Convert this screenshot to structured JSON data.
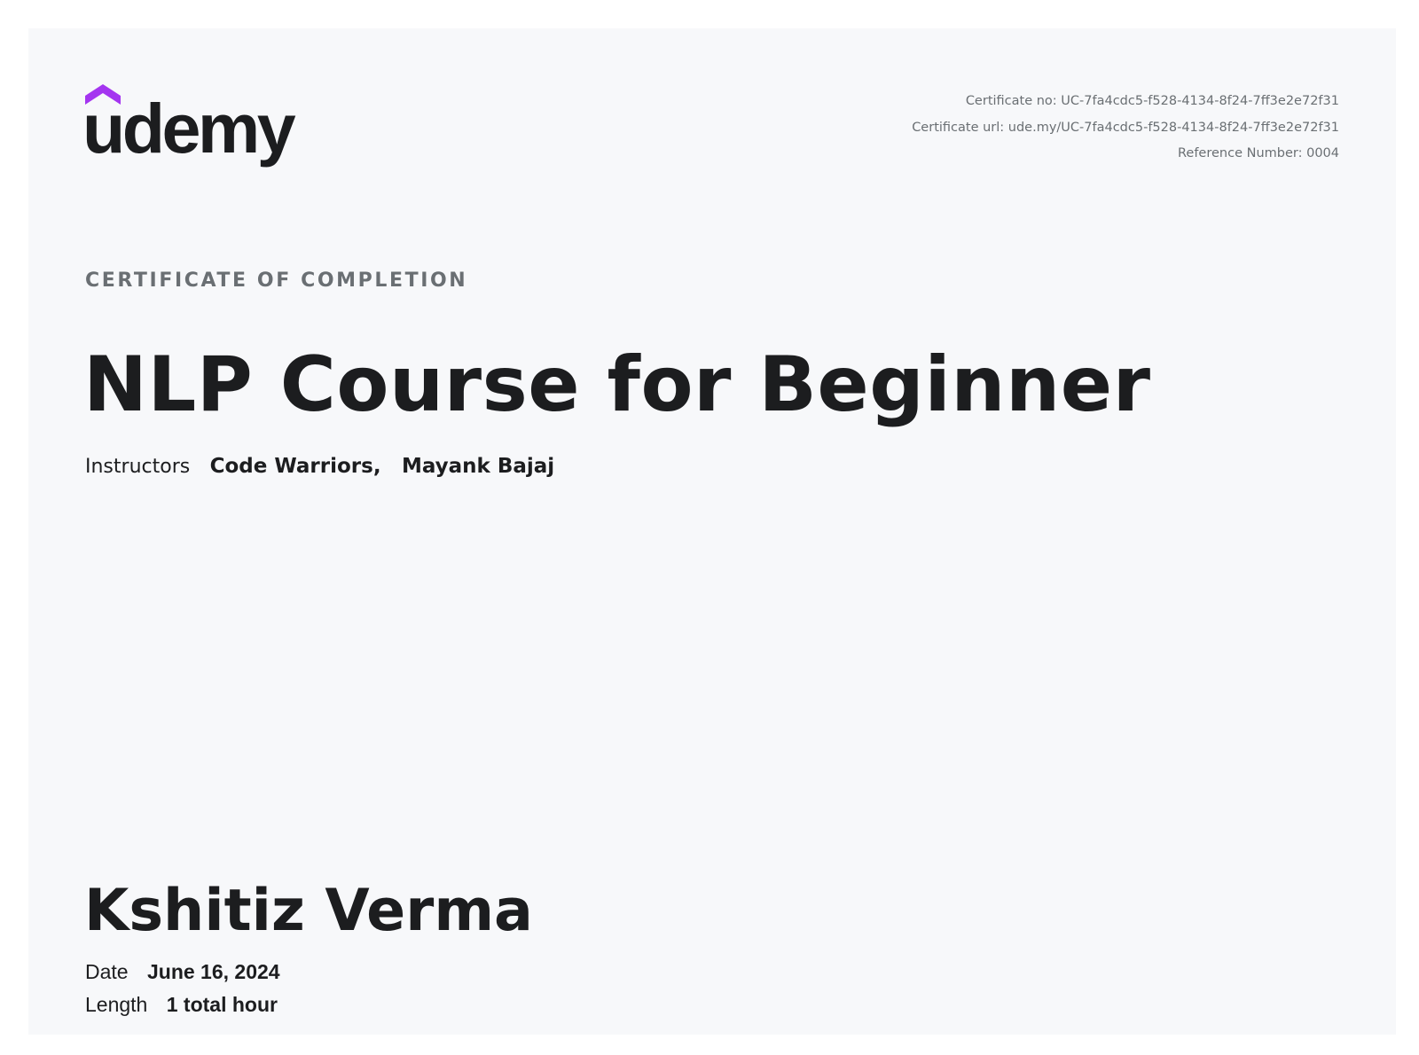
{
  "logo": {
    "wordmark": "udemy",
    "accent_color": "#a435f0",
    "icon": "udemy-logo-icon"
  },
  "certificate_meta": {
    "certificate_no": "Certificate no: UC-7fa4cdc5-f528-4134-8f24-7ff3e2e72f31",
    "certificate_url": "Certificate url: ude.my/UC-7fa4cdc5-f528-4134-8f24-7ff3e2e72f31",
    "reference_number": "Reference Number: 0004"
  },
  "heading": "CERTIFICATE OF COMPLETION",
  "course_title": "NLP Course for Beginner",
  "instructors": {
    "label": "Instructors",
    "names": [
      "Code Warriors,",
      "Mayank Bajaj"
    ]
  },
  "student_name": "Kshitiz Verma",
  "date": {
    "label": "Date",
    "value": "June 16, 2024"
  },
  "length": {
    "label": "Length",
    "value": "1 total hour"
  },
  "colors": {
    "background": "#f7f8fa",
    "text": "#1c1d1f",
    "muted": "#6a6f73"
  }
}
